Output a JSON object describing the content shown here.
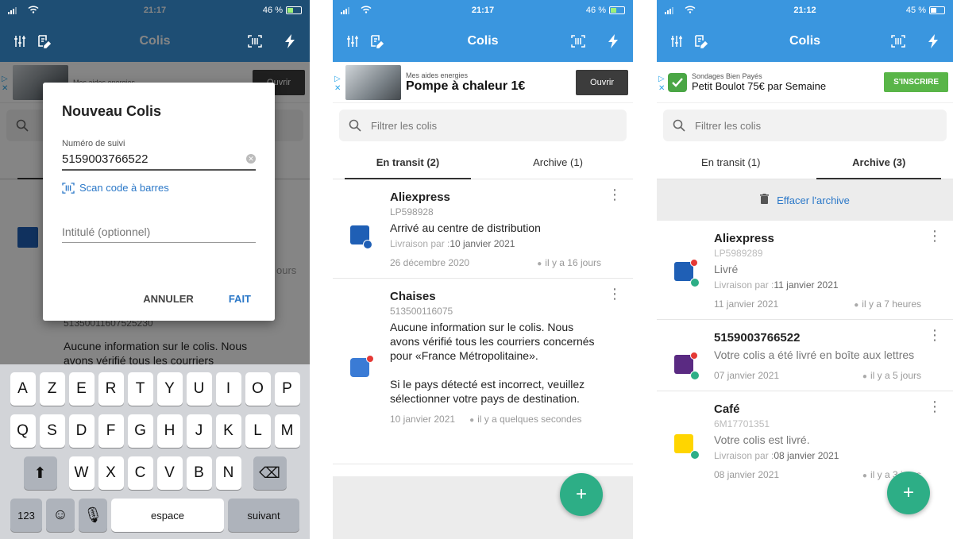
{
  "colors": {
    "primary": "#3a96df",
    "fab": "#2dae86",
    "link": "#2b78c8"
  },
  "screen1": {
    "status": {
      "time": "21:17",
      "battery": "46 %"
    },
    "title": "Colis",
    "ad_small": "Mes aides energies",
    "ad_button": "Ouvrir",
    "dialog": {
      "title": "Nouveau Colis",
      "tracking_label": "Numéro de suivi",
      "tracking_value": "5159003766522",
      "scan_label": "Scan code à barres",
      "name_placeholder": "Intitulé (optionnel)",
      "cancel": "ANNULER",
      "done": "FAIT"
    },
    "background": {
      "ours": "ours",
      "number": "51350011607525230",
      "info_line1": "Aucune information sur le colis. Nous",
      "info_line2": "avons vérifié tous les courriers"
    },
    "keyboard": {
      "row1": [
        "A",
        "Z",
        "E",
        "R",
        "T",
        "Y",
        "U",
        "I",
        "O",
        "P"
      ],
      "row2": [
        "Q",
        "S",
        "D",
        "F",
        "G",
        "H",
        "J",
        "K",
        "L",
        "M"
      ],
      "row3": [
        "W",
        "X",
        "C",
        "V",
        "B",
        "N"
      ],
      "num_key": "123",
      "space": "espace",
      "next": "suivant"
    }
  },
  "screen2": {
    "status": {
      "time": "21:17",
      "battery": "46 %"
    },
    "title": "Colis",
    "ad": {
      "small": "Mes aides energies",
      "big": "Pompe à chaleur 1€",
      "button": "Ouvrir"
    },
    "search_placeholder": "Filtrer les colis",
    "tabs": [
      "En transit (2)",
      "Archive (1)"
    ],
    "parcels": [
      {
        "name": "Aliexpress",
        "number": "LP598928",
        "status": "Arrivé au centre de distribution",
        "delivery_label": "Livraison par :",
        "delivery_date": "10 janvier 2021",
        "date": "26 décembre 2020",
        "ago": "il y a 16 jours"
      },
      {
        "name": "Chaises",
        "number": "513500116075",
        "status": "Aucune information sur le colis. Nous avons vérifié tous les courriers concernés pour «France Métropolitaine».",
        "status2": "Si le pays détecté est incorrect, veuillez sélectionner votre pays de destination.",
        "date": "10 janvier 2021",
        "ago": "il y a quelques secondes"
      }
    ],
    "fab": "+"
  },
  "screen3": {
    "status": {
      "time": "21:12",
      "battery": "45 %"
    },
    "title": "Colis",
    "ad": {
      "small": "Sondages Bien Payés",
      "big": "Petit Boulot 75€ par Semaine",
      "button": "S'INSCRIRE"
    },
    "search_placeholder": "Filtrer les colis",
    "tabs": [
      "En transit (1)",
      "Archive (3)"
    ],
    "clear_archive": "Effacer l'archive",
    "parcels": [
      {
        "name": "Aliexpress",
        "number": "LP5989289",
        "status": "Livré",
        "delivery_label": "Livraison par :",
        "delivery_date": "11 janvier 2021",
        "date": "11 janvier 2021",
        "ago": "il y a 7 heures"
      },
      {
        "name": "5159003766522",
        "status": "Votre colis a été livré en boîte aux lettres",
        "date": "07 janvier 2021",
        "ago": "il y a 5 jours"
      },
      {
        "name": "Café",
        "number": "6M17701351",
        "status": "Votre colis est livré.",
        "delivery_label": "Livraison par :",
        "delivery_date": "08 janvier 2021",
        "date": "08 janvier 2021",
        "ago": "il y a 3 jours"
      }
    ],
    "fab": "+"
  }
}
